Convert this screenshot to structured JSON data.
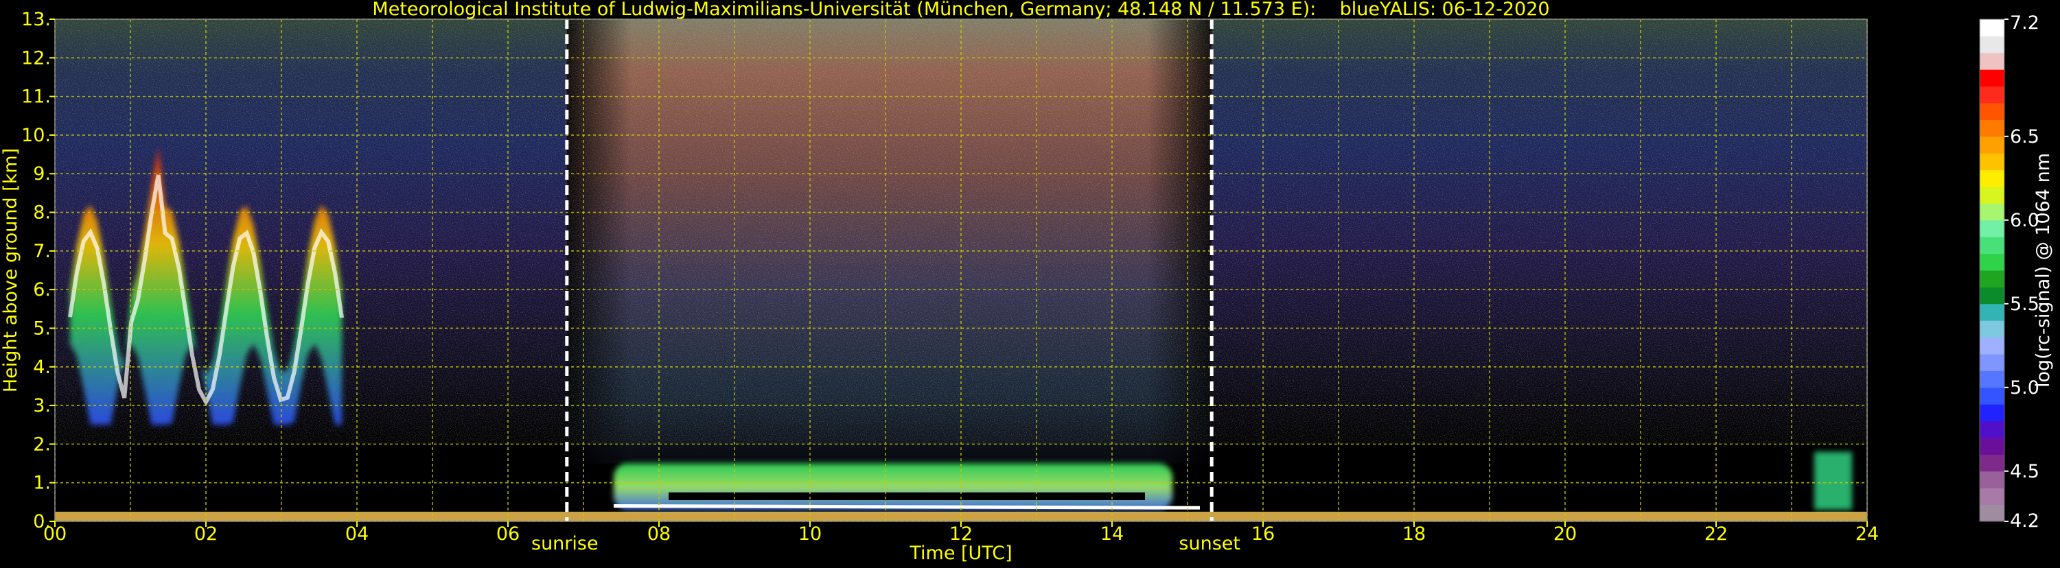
{
  "chart_data": {
    "type": "heatmap",
    "title": "Meteorological Institute of Ludwig-Maximilians-Universität (München, Germany; 48.148 N / 11.573 E):    blueYALIS: 06-12-2020",
    "xlabel": "Time [UTC]",
    "ylabel": "Height above ground [km]",
    "xlim": [
      0,
      24
    ],
    "ylim": [
      0,
      13
    ],
    "x_ticks": [
      "00",
      "02",
      "04",
      "06",
      "08",
      "10",
      "12",
      "14",
      "16",
      "18",
      "20",
      "22",
      "24"
    ],
    "y_ticks": [
      "0.",
      "1.",
      "2.",
      "3.",
      "4.",
      "5.",
      "6.",
      "7.",
      "8.",
      "9.",
      "10.",
      "11.",
      "12.",
      "13."
    ],
    "grid": true,
    "markers": [
      {
        "label": "sunrise",
        "x": 6.78
      },
      {
        "label": "sunset",
        "x": 15.32
      }
    ],
    "colorbar": {
      "label": "log(rc-signal) @ 1064 nm",
      "range": [
        4.2,
        7.2
      ],
      "tick_labels": [
        "7.2",
        "6.5",
        "6.0",
        "5.5",
        "5.0",
        "4.5",
        "4.2"
      ],
      "tick_values": [
        7.2,
        6.5,
        6.0,
        5.5,
        5.0,
        4.5,
        4.2
      ],
      "colors": [
        "#a08ca0",
        "#a87aa8",
        "#9a609a",
        "#7d2a8a",
        "#6a0f9a",
        "#5010c8",
        "#2222ff",
        "#3355ff",
        "#5577ff",
        "#7f96ff",
        "#9eb0ff",
        "#7fc9e0",
        "#33b4b4",
        "#0b8b2c",
        "#20a520",
        "#2ed34a",
        "#49e07a",
        "#72f0a5",
        "#a8f570",
        "#d9f520",
        "#ffee00",
        "#ffc200",
        "#ffa000",
        "#ff7a00",
        "#ff5500",
        "#ff2a1c",
        "#ff0000",
        "#f0c3c3",
        "#e8e8e8",
        "#ffffff"
      ]
    },
    "features": [
      {
        "name": "cirrus_cloud",
        "time_range": [
          0.2,
          3.8
        ],
        "height_range": [
          2.5,
          10.0
        ],
        "value": "6.5-7.2"
      },
      {
        "name": "boundary_layer_aerosol",
        "time_range": [
          7.4,
          14.8
        ],
        "height_range": [
          0.3,
          1.5
        ],
        "value": "5.5-6.2"
      },
      {
        "name": "low_cloud",
        "time_range": [
          23.3,
          23.8
        ],
        "height_range": [
          0.3,
          1.8
        ],
        "value": "5.5-7.2"
      }
    ]
  }
}
